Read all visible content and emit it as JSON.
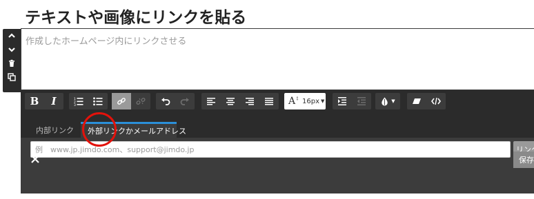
{
  "page_title": "テキストや画像にリンクを貼る",
  "editor": {
    "placeholder": "作成したホームページ内にリンクさせる"
  },
  "toolbar": {
    "font_size_value": "16px",
    "buttons": [
      "bold",
      "italic",
      "ordered-list",
      "unordered-list",
      "link",
      "unlink",
      "undo",
      "redo",
      "align-left",
      "align-center",
      "align-right",
      "align-justify",
      "font-size",
      "indent",
      "outdent",
      "color",
      "eraser",
      "source-code"
    ]
  },
  "link_panel": {
    "tabs": [
      {
        "label": "内部リンク",
        "active": false
      },
      {
        "label": "外部リンクかメールアドレス",
        "active": true
      }
    ],
    "url_placeholder": "例　www.jp.jimdo.com、support@jimdo.jp",
    "link_button_label": "リンク",
    "save_button_label": "保存"
  },
  "colors": {
    "panel_dark": "#2b2b2b",
    "panel_mid": "#3c3c3c",
    "active_tab_accent": "#2b90d9",
    "annotation_red": "#e3120b"
  }
}
